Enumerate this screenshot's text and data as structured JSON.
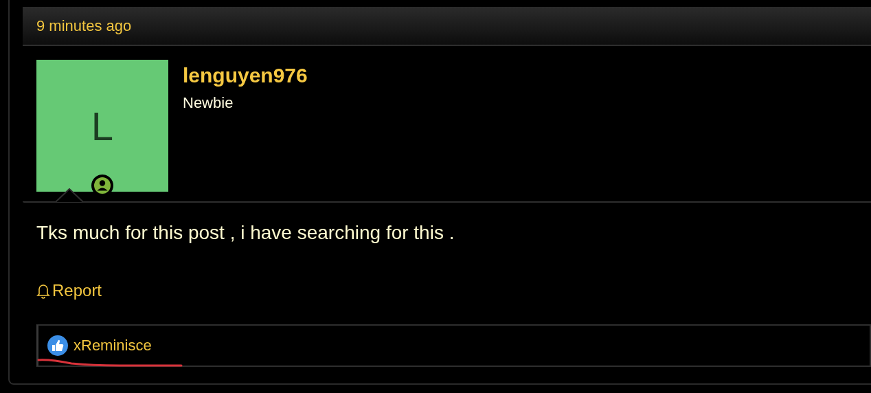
{
  "post": {
    "time": "9 minutes ago",
    "author": {
      "initial": "L",
      "name": "lenguyen976",
      "title": "Newbie"
    },
    "message": "Tks much for this post , i have searching for this .",
    "actions": [
      "Report"
    ],
    "reactions": {
      "users": [
        "xReminisce"
      ]
    }
  }
}
